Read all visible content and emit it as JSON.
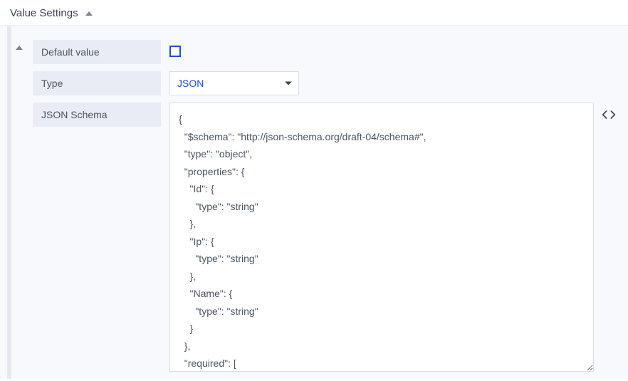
{
  "section": {
    "title": "Value Settings"
  },
  "fields": {
    "default_value": {
      "label": "Default value",
      "checked": false
    },
    "type": {
      "label": "Type",
      "selected": "JSON"
    },
    "json_schema": {
      "label": "JSON Schema",
      "value": "{\n  \"$schema\": \"http://json-schema.org/draft-04/schema#\",\n  \"type\": \"object\",\n  \"properties\": {\n    \"Id\": {\n      \"type\": \"string\"\n    },\n    \"Ip\": {\n      \"type\": \"string\"\n    },\n    \"Name\": {\n      \"type\": \"string\"\n    }\n  },\n  \"required\": ["
    }
  }
}
